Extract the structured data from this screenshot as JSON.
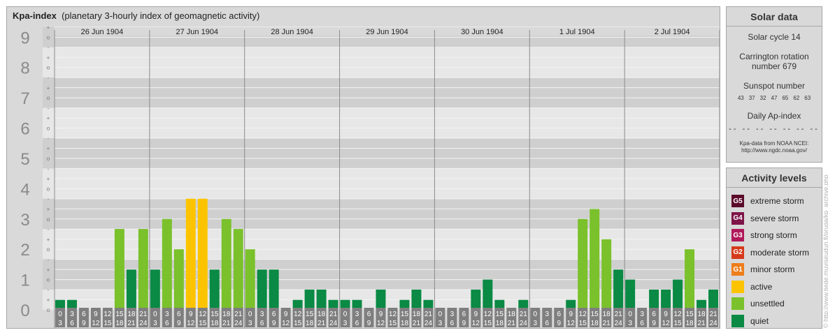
{
  "title_bold": "Kpa-index",
  "title_rest": "(planetary 3-hourly index of geomagnetic activity)",
  "solar": {
    "heading": "Solar data",
    "cycle": "Solar cycle 14",
    "carrington_line1": "Carrington rotation",
    "carrington_line2": "number 679",
    "sunspot_heading": "Sunspot number",
    "sunspots": [
      "43",
      "37",
      "32",
      "47",
      "65",
      "62",
      "63"
    ],
    "ap_heading": "Daily Ap-index",
    "ap_values": "-- -- -- -- -- -- --",
    "source_line1": "Kpa-data from NOAA NCEI:",
    "source_line2": "http://www.ngdc.noaa.gov/"
  },
  "levels": {
    "heading": "Activity levels",
    "items": [
      {
        "badge": "G5",
        "label": "extreme storm",
        "color": "#5c0a2a"
      },
      {
        "badge": "G4",
        "label": "severe storm",
        "color": "#7e1448"
      },
      {
        "badge": "G3",
        "label": "strong storm",
        "color": "#b0185a"
      },
      {
        "badge": "G2",
        "label": "moderate storm",
        "color": "#d63a1a"
      },
      {
        "badge": "G1",
        "label": "minor storm",
        "color": "#ee7d1b"
      },
      {
        "badge": "",
        "label": "active",
        "color": "#fcc400"
      },
      {
        "badge": "",
        "label": "unsettled",
        "color": "#7ac12b"
      },
      {
        "badge": "",
        "label": "quiet",
        "color": "#0a8a44"
      }
    ]
  },
  "copyright": "© http://www.tiede.muviseudun.fi/pruga/kp_archive.php",
  "chart_data": {
    "type": "bar",
    "days": [
      "26 Jun 1904",
      "27 Jun 1904",
      "28 Jun 1904",
      "29 Jun 1904",
      "30 Jun 1904",
      "1 Jul 1904",
      "2 Jul 1904"
    ],
    "slot_labels": [
      [
        "0",
        "3"
      ],
      [
        "3",
        "6"
      ],
      [
        "6",
        "9"
      ],
      [
        "9",
        "12"
      ],
      [
        "12",
        "15"
      ],
      [
        "15",
        "18"
      ],
      [
        "18",
        "21"
      ],
      [
        "21",
        "24"
      ]
    ],
    "y_ticks": [
      "0",
      "1",
      "2",
      "3",
      "4",
      "5",
      "6",
      "7",
      "8",
      "9"
    ],
    "sub_ticks": [
      "o",
      "-",
      "+"
    ],
    "ylim": [
      0,
      9.33
    ],
    "values": [
      0.33,
      0.33,
      0.0,
      0.0,
      0.0,
      2.67,
      1.33,
      2.67,
      1.33,
      3.0,
      2.0,
      3.67,
      3.67,
      1.33,
      3.0,
      2.67,
      2.0,
      1.33,
      1.33,
      0.0,
      0.33,
      0.67,
      0.67,
      0.33,
      0.33,
      0.33,
      0.0,
      0.67,
      0.0,
      0.33,
      0.67,
      0.33,
      0.0,
      0.0,
      0.0,
      0.67,
      1.0,
      0.33,
      0.0,
      0.33,
      0.0,
      0.0,
      0.0,
      0.33,
      3.0,
      3.33,
      2.33,
      1.33,
      1.0,
      0.0,
      0.67,
      0.67,
      1.0,
      2.0,
      0.33,
      0.67
    ],
    "colors": {
      "quiet": "#0a8a44",
      "unsettled": "#7ac12b",
      "active": "#fcc400"
    }
  }
}
